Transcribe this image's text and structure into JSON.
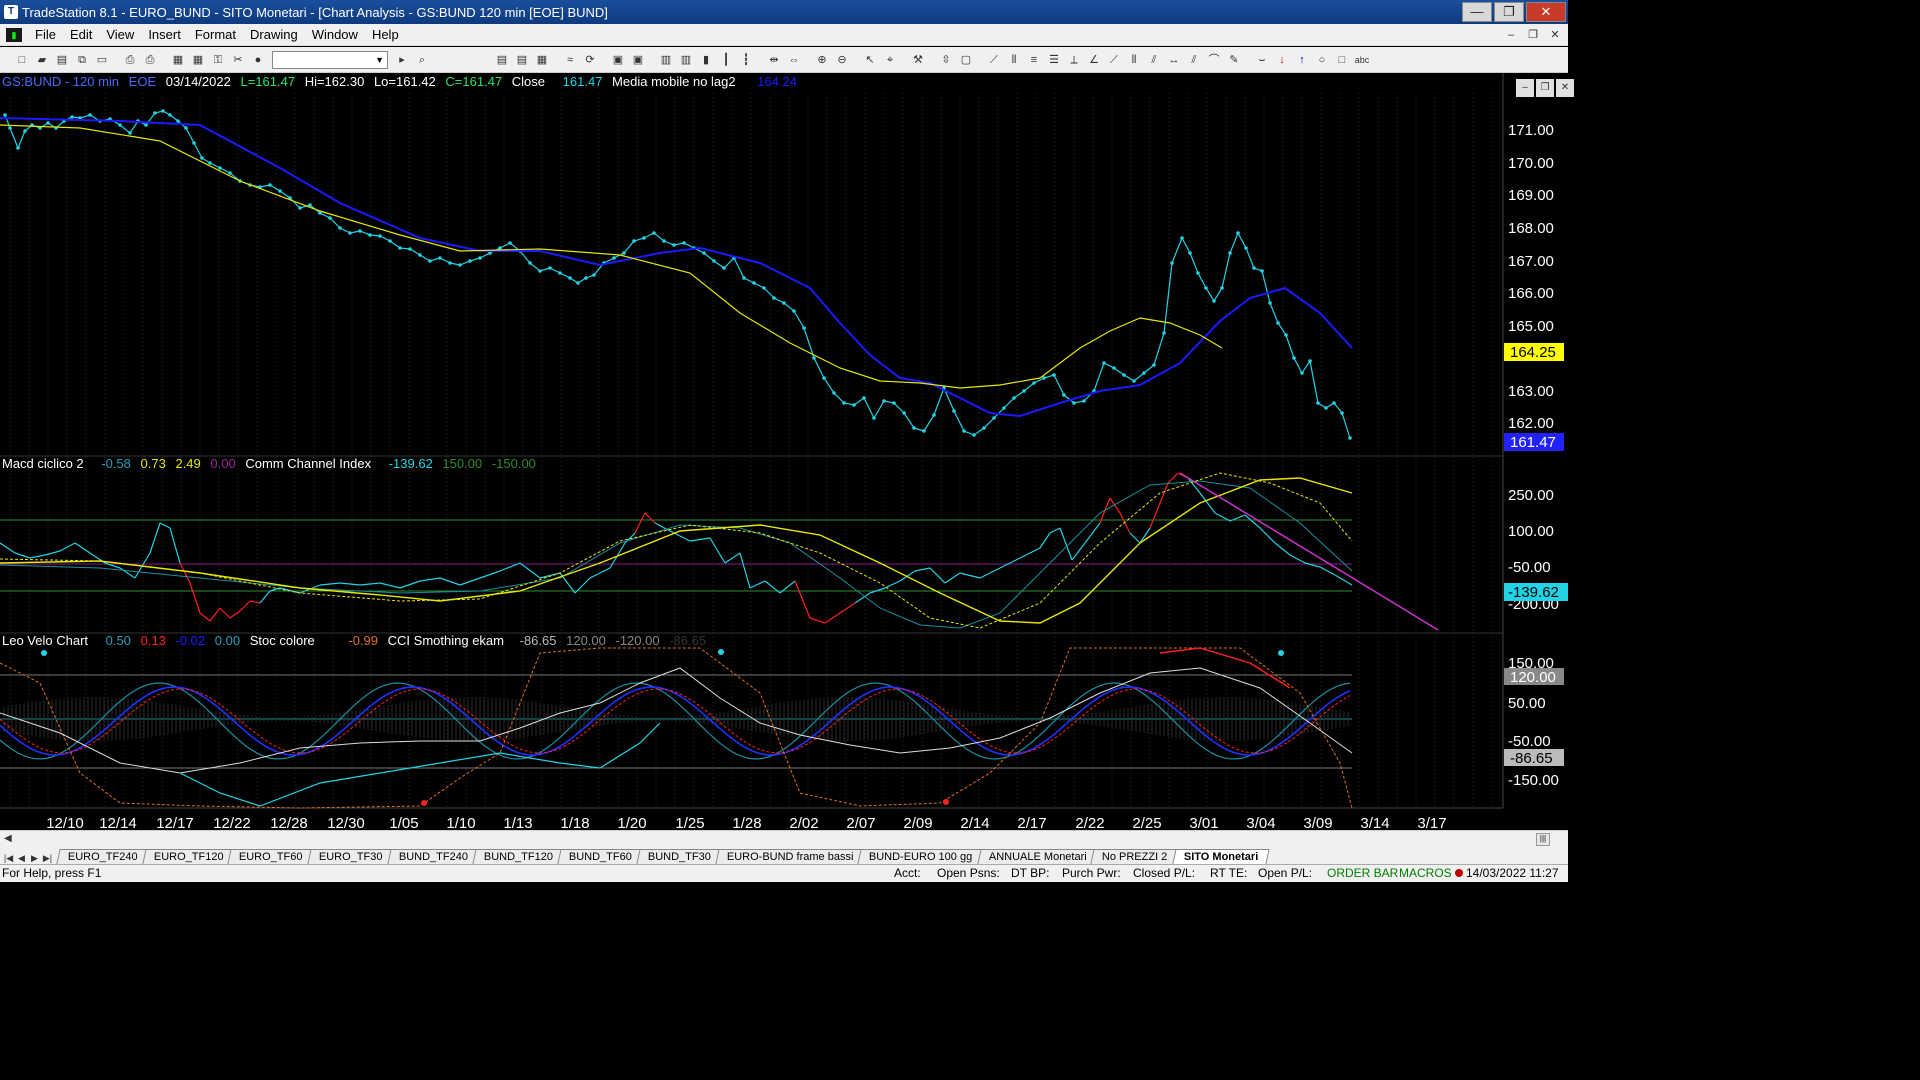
{
  "window": {
    "title": "TradeStation 8.1 - EURO_BUND - SITO Monetari - [Chart Analysis - GS:BUND  120 min  [EOE] BUND]",
    "minimize": "—",
    "maximize": "❐",
    "close": "✕"
  },
  "menu": [
    "File",
    "Edit",
    "View",
    "Insert",
    "Format",
    "Drawing",
    "Window",
    "Help"
  ],
  "chart_header": {
    "symbol": "GS:BUND - 120 min",
    "session": "EOE",
    "date": "03/14/2022",
    "low": "L=161.47",
    "high": "Hi=162.30",
    "lo": "Lo=161.42",
    "close": "C=161.47",
    "close_label": "Close",
    "close_value": "161.47",
    "ma_name": "Media mobile no lag2",
    "ma_value": "164.24"
  },
  "macd_header": {
    "name": "Macd ciclico 2",
    "v1": "-0.58",
    "v2": "0.73",
    "v3": "2.49",
    "v4": "0.00",
    "cci_name": "Comm Channel Index",
    "cci_v1": "-139.62",
    "cci_v2": "150.00",
    "cci_v3": "-150.00"
  },
  "leo_header": {
    "name": "Leo Velo Chart",
    "v1": "0.50",
    "v2": "0.13",
    "v3": "-0.02",
    "v4": "0.00",
    "stoc_name": "Stoc colore",
    "stoc_v": "-0.99",
    "cci_name": "CCI Smothing ekam",
    "cci_v1": "-86.65",
    "cci_v2": "120.00",
    "cci_v3": "-120.00",
    "cci_v4": "-86.65"
  },
  "price_axis": [
    "171.00",
    "170.00",
    "169.00",
    "168.00",
    "167.00",
    "166.00",
    "165.00",
    "163.00",
    "162.00"
  ],
  "price_markers": {
    "ma": "164.25",
    "close": "161.47"
  },
  "macd_axis": [
    "250.00",
    "100.00",
    "-50.00",
    "-200.00"
  ],
  "macd_marker": "-139.62",
  "leo_axis": [
    "150.00",
    "50.00",
    "-50.00",
    "-150.00"
  ],
  "leo_markers": {
    "upper": "120.00",
    "cci": "-86.65",
    "lower": "-120.00"
  },
  "dates": [
    "12/10",
    "12/14",
    "12/17",
    "12/22",
    "12/28",
    "12/30",
    "1/05",
    "1/10",
    "1/13",
    "1/18",
    "1/20",
    "1/25",
    "1/28",
    "2/02",
    "2/07",
    "2/09",
    "2/14",
    "2/17",
    "2/22",
    "2/25",
    "3/01",
    "3/04",
    "3/09",
    "3/14",
    "3/17"
  ],
  "tabs": [
    "EURO_TF240",
    "EURO_TF120",
    "EURO_TF60",
    "EURO_TF30",
    "BUND_TF240",
    "BUND_TF120",
    "BUND_TF60",
    "BUND_TF30",
    "EURO-BUND frame bassi",
    "BUND-EURO 100 gg",
    "ANNUALE Monetari",
    "No PREZZI 2",
    "SITO Monetari"
  ],
  "status": {
    "help": "For Help, press F1",
    "acct": "Acct:",
    "open_psns": "Open Psns:",
    "dt_bp": "DT BP:",
    "purch_pwr": "Purch Pwr:",
    "closed_pl": "Closed P/L:",
    "rt_te": "RT TE:",
    "open_pl": "Open P/L:",
    "order_bar": "ORDER BAR",
    "macros": "MACROS",
    "datetime": "14/03/2022 11:27"
  },
  "colors": {
    "price_dots": "#22d3e6",
    "ma_blue": "#1a1aff",
    "ma_yellow": "#e6e600",
    "cci_red": "#ff2020",
    "magenta": "#cc33cc",
    "green_line": "#2e8b2e"
  }
}
